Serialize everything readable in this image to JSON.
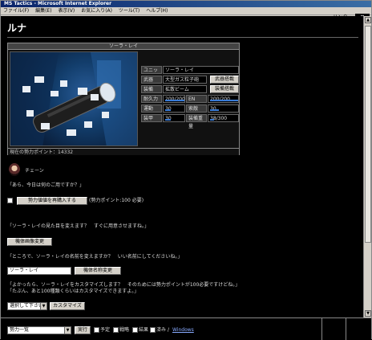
{
  "window": {
    "title": "MS Tactics - Microsoft Internet Explorer"
  },
  "menu": [
    "ファイル(F)",
    "編集(E)",
    "表示(V)",
    "お気に入り(A)",
    "ツール(T)",
    "ヘルプ(H)"
  ],
  "links_label": "リンク »",
  "page": {
    "title": "ルナ"
  },
  "unit": {
    "header": "ソーラ・レイ",
    "footer": "現在の勢力ポイント：14332",
    "stats": {
      "unit_label": "ユニット",
      "unit_value": "ソーラ・レイ",
      "weapon_label": "武器",
      "weapon_value": "大型ガス粒子砲",
      "weapon_button": "武器搭載",
      "equip_label": "装備",
      "equip_value": "拡散ビーム",
      "equip_button": "装備搭載",
      "hp_label": "耐久力",
      "hp_value": "200/200",
      "en_label": "EN",
      "en_value": "200/200",
      "mobility_label": "運動",
      "mobility_value": "30",
      "speed_label": "索敵",
      "speed_value": "30",
      "armor_label": "装甲",
      "armor_value": "30",
      "weight_label": "装備重量",
      "weight_value": "38/300"
    },
    "bars": {
      "hp": 1.0,
      "en": 1.0,
      "mobility": 0.3,
      "speed": 0.3,
      "armor": 0.3,
      "weight": 0.13
    }
  },
  "chat": {
    "speaker": "チェーン",
    "line1": "「あら、今日は何のご用ですか？」",
    "recalc_button": "勢力値値を再購入する",
    "recalc_note": "(勢力ポイント:100 必要)",
    "line2": "「ソーラ・レイの見た目を変えます？　すぐに用意させますね。」",
    "change_image_button": "機体画像変更",
    "line3": "「ところで、ソーラ・レイの名前を変えますか？　いい名前にしてくださいね。」",
    "name_input_value": "ソーラ・レイ",
    "change_name_button": "機体名称変更",
    "line4": "「よかったら、ソーラ・レイをカスタマイズします？　そのためには勢力ポイントが100必要ですけどね。」",
    "line5": "「たぶん、あと100種類くらいはカスタマイズできますよ。」",
    "custom_select_value": "選択して下さい",
    "customize_button": "カスタマイズ"
  },
  "bottom": {
    "list_select_value": "勢力一覧",
    "exec_button": "実行",
    "checkboxes": [
      "予定",
      "戦略",
      "結果",
      "済み"
    ],
    "separator": "/",
    "link_text": "Windows"
  }
}
